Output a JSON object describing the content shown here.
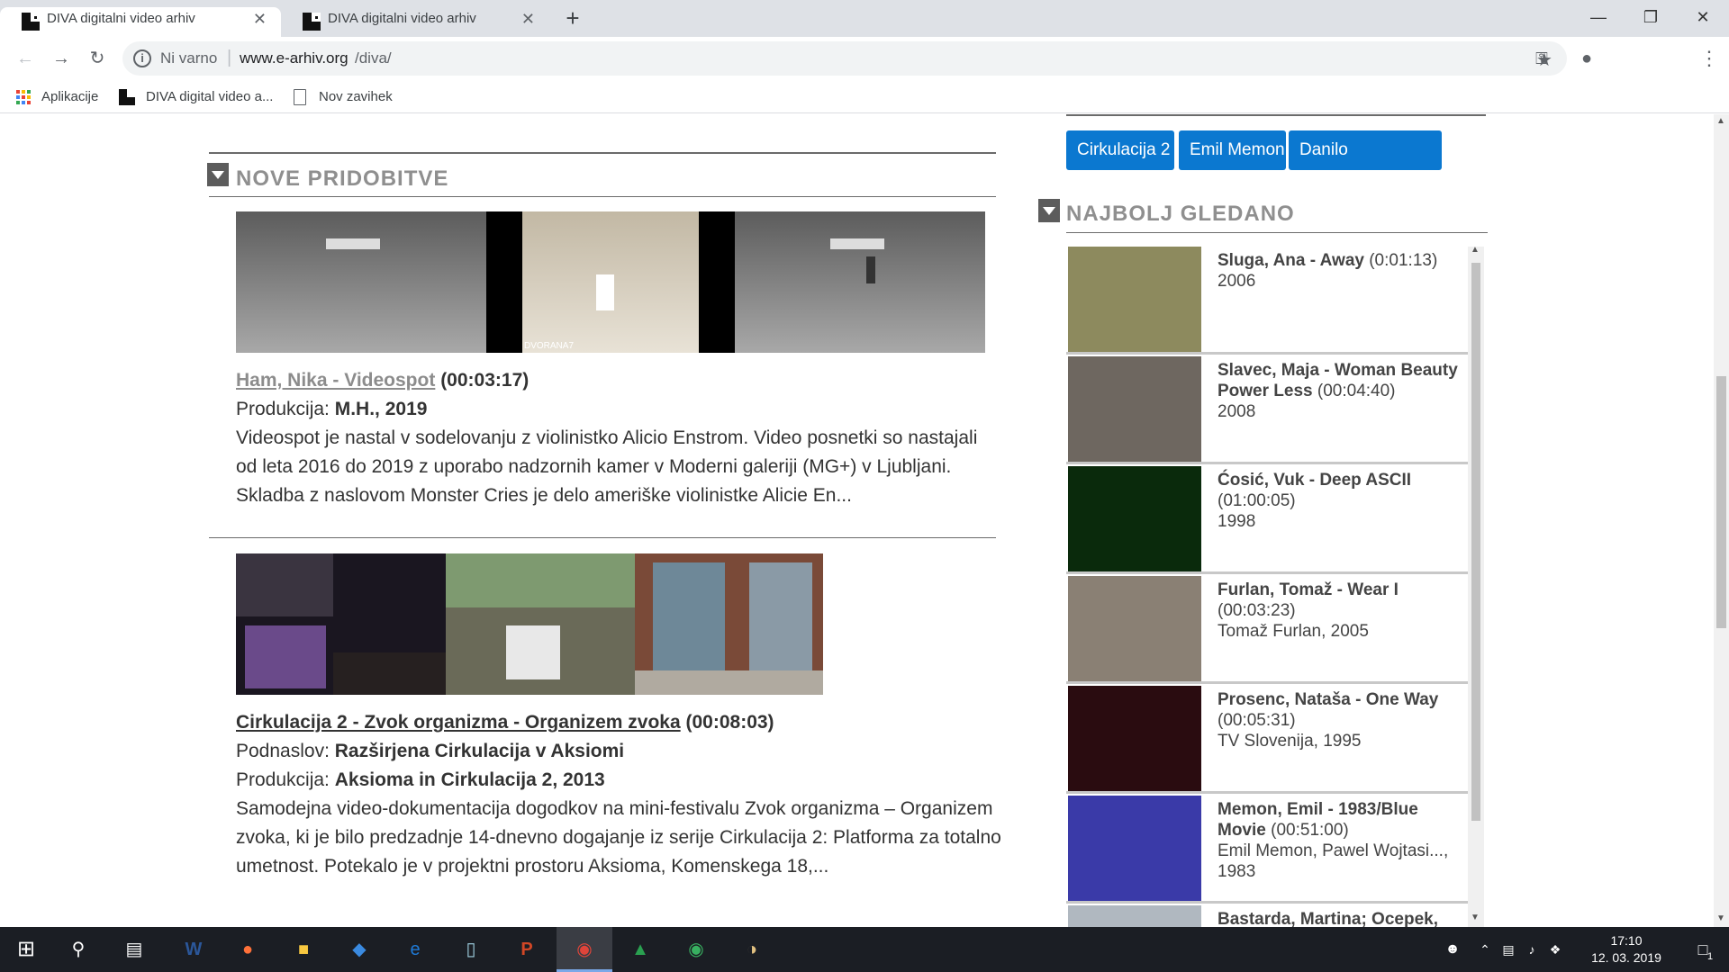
{
  "browser": {
    "tabs": [
      {
        "title": "DIVA digitalni video arhiv",
        "active": true
      },
      {
        "title": "DIVA digitalni video arhiv",
        "active": false
      }
    ],
    "new_tab": "+",
    "not_secure": "Ni varno",
    "url_host": "www.e-arhiv.org",
    "url_path": "/diva/",
    "bookmarks": [
      {
        "label": "Aplikacije",
        "icon": "apps-grid-icon"
      },
      {
        "label": "DIVA digital video a...",
        "icon": "diva-favicon"
      },
      {
        "label": "Nov zavihek",
        "icon": "page-icon"
      }
    ]
  },
  "nove": {
    "heading": "NOVE PRIDOBITVE",
    "items": [
      {
        "title": "Ham, Nika - Videospot",
        "duration": "(00:03:17)",
        "fields": [
          {
            "label": "Produkcija: ",
            "value": "M.H.",
            "rest": ", 2019"
          }
        ],
        "desc": "Videospot je nastal v sodelovanju z violinistko Alicio Enstrom. Video posnetki so nastajali od leta 2016 do 2019 z uporabo nadzornih kamer v Moderni galeriji (MG+) v Ljubljani. Skladba z naslovom Monster Cries je delo ameriške violinistke Alicie En...",
        "thumb_caption": "DVORANA7"
      },
      {
        "title": "Cirkulacija 2 - Zvok organizma - Organizem zvoka",
        "duration": "(00:08:03)",
        "fields": [
          {
            "label": "Podnaslov: ",
            "value": "Razširjena Cirkulacija v Aksiomi",
            "rest": ""
          },
          {
            "label": "Produkcija: ",
            "value": "Aksioma in Cirkulacija 2",
            "rest": ", 2013"
          }
        ],
        "desc": "Samodejna video-dokumentacija dogodkov na mini-festivalu Zvok organizma – Organizem zvoka, ki je bilo predzadnje 14-dnevno dogajanje  iz serije Cirkulacija 2: Platforma za totalno umetnost. Potekalo je v projektni prostoru Aksioma, Komenskega 18,..."
      }
    ]
  },
  "tags": [
    "Cirkulacija 2",
    "Emil Memon",
    "Danilo Milovanović"
  ],
  "najbolj": {
    "heading": "NAJBOLJ GLEDANO",
    "items": [
      {
        "title": "Sluga, Ana - Away",
        "duration": "(0:01:13)",
        "meta": "2006",
        "color": "#8d8a5e"
      },
      {
        "title": "Slavec, Maja - Woman Beauty Power Less",
        "duration": "(00:04:40)",
        "meta": "2008",
        "color": "#6e6760"
      },
      {
        "title": "Ćosić, Vuk - Deep ASCII",
        "duration": "(01:00:05)",
        "meta": "1998",
        "color": "#0a2a0c"
      },
      {
        "title": "Furlan, Tomaž - Wear I",
        "duration": "(00:03:23)",
        "meta": "Tomaž Furlan, 2005",
        "color": "#8a8074"
      },
      {
        "title": "Prosenc, Nataša - One Way",
        "duration": "(00:05:31)",
        "meta": "TV Slovenija, 1995",
        "color": "#2a0c10"
      },
      {
        "title": "Memon, Emil - 1983/Blue Movie",
        "duration": "(00:51:00)",
        "meta": "Emil Memon, Pawel Wojtasi..., 1983",
        "color": "#3a3aa8"
      },
      {
        "title": "Bastarda, Martina; Ocepek,",
        "duration": "",
        "meta": "",
        "color": "#b0b8c0"
      }
    ]
  },
  "taskbar": {
    "time": "17:10",
    "date": "12. 03. 2019",
    "notification_count": "1"
  }
}
